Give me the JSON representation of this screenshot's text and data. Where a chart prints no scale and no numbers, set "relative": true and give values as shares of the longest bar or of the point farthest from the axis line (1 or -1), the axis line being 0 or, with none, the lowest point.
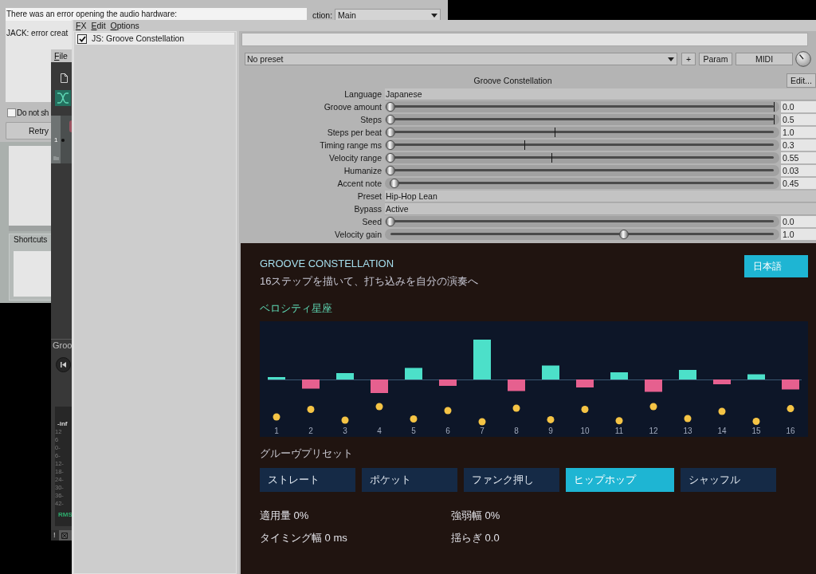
{
  "error_dialog": {
    "message": [
      "There was an error opening the audio hardware:",
      "JACK: error creat"
    ],
    "section": {
      "label": "ction:",
      "value": "Main"
    },
    "dont_show": {
      "label": "Do not sh",
      "checked": false
    },
    "retry_button": "Retry",
    "shortcuts_label": "Shortcuts"
  },
  "main_window": {
    "menu": [
      "File"
    ],
    "track_number": "1",
    "track_name": "Groo",
    "meter": {
      "peak": "-inf",
      "scale": [
        "12",
        "6",
        "0-",
        "6-",
        "12-",
        "18-",
        "24-",
        "30-",
        "36-",
        "42-"
      ],
      "mode": "RMS"
    },
    "bottom_bar": {
      "status": "!"
    }
  },
  "fx_window": {
    "menu": [
      "FX",
      "Edit",
      "Options"
    ],
    "chain": [
      {
        "name": "JS: Groove Constellation",
        "enabled": true,
        "selected": true
      }
    ],
    "preset": "No preset",
    "buttons": [
      "+",
      "Param",
      "MIDI"
    ],
    "plugin_title": "Groove Constellation",
    "edit_button": "Edit...",
    "params": [
      {
        "kind": "choice",
        "label": "Language",
        "value": "Japanese"
      },
      {
        "kind": "slider",
        "label": "Groove amount",
        "level": 0,
        "marker": {
          "level": 1
        },
        "value": "0.0"
      },
      {
        "kind": "slider",
        "label": "Steps",
        "level": 0,
        "marker": {
          "level": 1
        },
        "value": "0.5"
      },
      {
        "kind": "slider",
        "label": "Steps per beat",
        "level": 0,
        "marker": {
          "level": 0.43
        },
        "value": "1.0"
      },
      {
        "kind": "slider",
        "label": "Timing range ms",
        "level": 0,
        "marker": {
          "level": 0.35
        },
        "value": "0.3"
      },
      {
        "kind": "slider",
        "label": "Velocity range",
        "level": 0,
        "marker": {
          "level": 0.42
        },
        "value": "0.55"
      },
      {
        "kind": "slider",
        "label": "Humanize",
        "level": 0,
        "value": "0.03"
      },
      {
        "kind": "slider",
        "label": "Accent note",
        "level": 0.01,
        "value": "0.45"
      },
      {
        "kind": "choice",
        "label": "Preset",
        "value": "Hip-Hop Lean"
      },
      {
        "kind": "choice",
        "label": "Bypass",
        "value": "Active"
      },
      {
        "kind": "slider",
        "label": "Seed",
        "level": 0,
        "value": "0.0"
      },
      {
        "kind": "slider",
        "label": "Velocity gain",
        "level": 0.61,
        "value": "1.0"
      }
    ]
  },
  "plugin_ui": {
    "title": "GROOVE CONSTELLATION",
    "subtitle": "16ステップを描いて、打ち込みを自分の演奏へ",
    "language_button": "日本語",
    "chart_label": "ベロシティ星座",
    "chart_data": {
      "type": "bar",
      "relative": true,
      "categories": [
        "1",
        "2",
        "3",
        "4",
        "5",
        "6",
        "7",
        "8",
        "9",
        "10",
        "11",
        "12",
        "13",
        "14",
        "15",
        "16"
      ],
      "series": [
        {
          "color": "#4ce0c9",
          "values": [
            0.06,
            null,
            0.16,
            null,
            0.29,
            null,
            1.0,
            null,
            0.35,
            null,
            0.18,
            null,
            0.24,
            null,
            0.13,
            null
          ]
        },
        {
          "color": "#e6608f",
          "values": [
            null,
            -0.23,
            null,
            -0.34,
            null,
            -0.16,
            null,
            -0.29,
            null,
            -0.2,
            null,
            -0.31,
            null,
            -0.12,
            null,
            -0.25
          ]
        }
      ]
    },
    "presets_label": "グルーヴプリセット",
    "presets": [
      {
        "label": "ストレート",
        "selected": false
      },
      {
        "label": "ポケット",
        "selected": false
      },
      {
        "label": "ファンク押し",
        "selected": false
      },
      {
        "label": "ヒップホップ",
        "selected": true
      },
      {
        "label": "シャッフル",
        "selected": false
      }
    ],
    "stats": [
      "適用量 0%",
      "強弱幅 0%",
      "タイミング幅 0 ms",
      "揺らぎ 0.0"
    ]
  }
}
